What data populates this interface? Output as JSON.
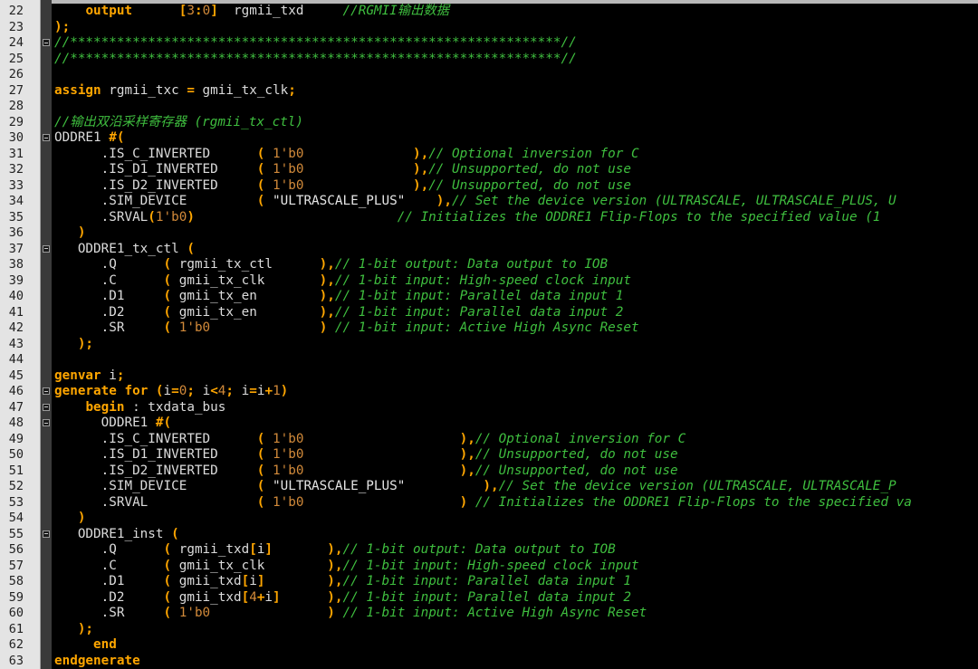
{
  "editor": {
    "first_line": 22,
    "lines": [
      {
        "no": "22",
        "fold": false,
        "tokens": [
          {
            "t": "    ",
            "c": "i"
          },
          {
            "t": "output",
            "c": "k"
          },
          {
            "t": "      ",
            "c": "i"
          },
          {
            "t": "[",
            "c": "p"
          },
          {
            "t": "3",
            "c": "n"
          },
          {
            "t": ":",
            "c": "p"
          },
          {
            "t": "0",
            "c": "n"
          },
          {
            "t": "]",
            "c": "p"
          },
          {
            "t": "  rgmii_txd     ",
            "c": "i"
          },
          {
            "t": "//RGMII输出数据",
            "c": "c"
          }
        ]
      },
      {
        "no": "23",
        "fold": false,
        "tokens": [
          {
            "t": ");",
            "c": "p"
          }
        ]
      },
      {
        "no": "24",
        "fold": true,
        "tokens": [
          {
            "t": "//***************************************************************//",
            "c": "c"
          }
        ]
      },
      {
        "no": "25",
        "fold": false,
        "tokens": [
          {
            "t": "//***************************************************************//",
            "c": "c"
          }
        ]
      },
      {
        "no": "26",
        "fold": false,
        "tokens": []
      },
      {
        "no": "27",
        "fold": false,
        "tokens": [
          {
            "t": "assign",
            "c": "k"
          },
          {
            "t": " rgmii_txc ",
            "c": "i"
          },
          {
            "t": "=",
            "c": "p"
          },
          {
            "t": " gmii_tx_clk",
            "c": "i"
          },
          {
            "t": ";",
            "c": "p"
          }
        ]
      },
      {
        "no": "28",
        "fold": false,
        "tokens": []
      },
      {
        "no": "29",
        "fold": false,
        "tokens": [
          {
            "t": "//输出双沿采样寄存器 (rgmii_tx_ctl)",
            "c": "c"
          }
        ]
      },
      {
        "no": "30",
        "fold": true,
        "tokens": [
          {
            "t": "ODDRE1 ",
            "c": "i"
          },
          {
            "t": "#(",
            "c": "p"
          }
        ]
      },
      {
        "no": "31",
        "fold": false,
        "tokens": [
          {
            "t": "      .IS_C_INVERTED      ",
            "c": "i"
          },
          {
            "t": "(",
            "c": "p"
          },
          {
            "t": " ",
            "c": "i"
          },
          {
            "t": "1'b0",
            "c": "n"
          },
          {
            "t": "              ",
            "c": "i"
          },
          {
            "t": "),",
            "c": "p"
          },
          {
            "t": "// Optional inversion for C",
            "c": "c"
          }
        ]
      },
      {
        "no": "32",
        "fold": false,
        "tokens": [
          {
            "t": "      .IS_D1_INVERTED     ",
            "c": "i"
          },
          {
            "t": "(",
            "c": "p"
          },
          {
            "t": " ",
            "c": "i"
          },
          {
            "t": "1'b0",
            "c": "n"
          },
          {
            "t": "              ",
            "c": "i"
          },
          {
            "t": "),",
            "c": "p"
          },
          {
            "t": "// Unsupported, do not use",
            "c": "c"
          }
        ]
      },
      {
        "no": "33",
        "fold": false,
        "tokens": [
          {
            "t": "      .IS_D2_INVERTED     ",
            "c": "i"
          },
          {
            "t": "(",
            "c": "p"
          },
          {
            "t": " ",
            "c": "i"
          },
          {
            "t": "1'b0",
            "c": "n"
          },
          {
            "t": "              ",
            "c": "i"
          },
          {
            "t": "),",
            "c": "p"
          },
          {
            "t": "// Unsupported, do not use",
            "c": "c"
          }
        ]
      },
      {
        "no": "34",
        "fold": false,
        "tokens": [
          {
            "t": "      .SIM_DEVICE         ",
            "c": "i"
          },
          {
            "t": "(",
            "c": "p"
          },
          {
            "t": " ",
            "c": "i"
          },
          {
            "t": "\"ULTRASCALE_PLUS\"",
            "c": "s"
          },
          {
            "t": "    ",
            "c": "i"
          },
          {
            "t": "),",
            "c": "p"
          },
          {
            "t": "// Set the device version (ULTRASCALE, ULTRASCALE_PLUS, U",
            "c": "c"
          }
        ]
      },
      {
        "no": "35",
        "fold": false,
        "tokens": [
          {
            "t": "      .SRVAL",
            "c": "i"
          },
          {
            "t": "(",
            "c": "p"
          },
          {
            "t": "1'b0",
            "c": "n"
          },
          {
            "t": ")",
            "c": "p"
          },
          {
            "t": "                          ",
            "c": "i"
          },
          {
            "t": "// Initializes the ODDRE1 Flip-Flops to the specified value (1",
            "c": "c"
          }
        ]
      },
      {
        "no": "36",
        "fold": false,
        "tokens": [
          {
            "t": "   ",
            "c": "i"
          },
          {
            "t": ")",
            "c": "p"
          }
        ]
      },
      {
        "no": "37",
        "fold": true,
        "tokens": [
          {
            "t": "   ODDRE1_tx_ctl ",
            "c": "i"
          },
          {
            "t": "(",
            "c": "p"
          }
        ]
      },
      {
        "no": "38",
        "fold": false,
        "tokens": [
          {
            "t": "      .Q      ",
            "c": "i"
          },
          {
            "t": "(",
            "c": "p"
          },
          {
            "t": " rgmii_tx_ctl      ",
            "c": "i"
          },
          {
            "t": "),",
            "c": "p"
          },
          {
            "t": "// 1-bit output: Data output to IOB",
            "c": "c"
          }
        ]
      },
      {
        "no": "39",
        "fold": false,
        "tokens": [
          {
            "t": "      .C      ",
            "c": "i"
          },
          {
            "t": "(",
            "c": "p"
          },
          {
            "t": " gmii_tx_clk       ",
            "c": "i"
          },
          {
            "t": "),",
            "c": "p"
          },
          {
            "t": "// 1-bit input: High-speed clock input",
            "c": "c"
          }
        ]
      },
      {
        "no": "40",
        "fold": false,
        "tokens": [
          {
            "t": "      .D1     ",
            "c": "i"
          },
          {
            "t": "(",
            "c": "p"
          },
          {
            "t": " gmii_tx_en        ",
            "c": "i"
          },
          {
            "t": "),",
            "c": "p"
          },
          {
            "t": "// 1-bit input: Parallel data input 1",
            "c": "c"
          }
        ]
      },
      {
        "no": "41",
        "fold": false,
        "tokens": [
          {
            "t": "      .D2     ",
            "c": "i"
          },
          {
            "t": "(",
            "c": "p"
          },
          {
            "t": " gmii_tx_en        ",
            "c": "i"
          },
          {
            "t": "),",
            "c": "p"
          },
          {
            "t": "// 1-bit input: Parallel data input 2",
            "c": "c"
          }
        ]
      },
      {
        "no": "42",
        "fold": false,
        "tokens": [
          {
            "t": "      .SR     ",
            "c": "i"
          },
          {
            "t": "(",
            "c": "p"
          },
          {
            "t": " ",
            "c": "i"
          },
          {
            "t": "1'b0",
            "c": "n"
          },
          {
            "t": "              ",
            "c": "i"
          },
          {
            "t": ")",
            "c": "p"
          },
          {
            "t": " // 1-bit input: Active High Async Reset",
            "c": "c"
          }
        ]
      },
      {
        "no": "43",
        "fold": false,
        "tokens": [
          {
            "t": "   ",
            "c": "i"
          },
          {
            "t": ");",
            "c": "p"
          }
        ]
      },
      {
        "no": "44",
        "fold": false,
        "tokens": []
      },
      {
        "no": "45",
        "fold": false,
        "tokens": [
          {
            "t": "genvar",
            "c": "k"
          },
          {
            "t": " i",
            "c": "i"
          },
          {
            "t": ";",
            "c": "p"
          }
        ]
      },
      {
        "no": "46",
        "fold": true,
        "tokens": [
          {
            "t": "generate",
            "c": "k"
          },
          {
            "t": " ",
            "c": "i"
          },
          {
            "t": "for",
            "c": "k"
          },
          {
            "t": " ",
            "c": "i"
          },
          {
            "t": "(",
            "c": "p"
          },
          {
            "t": "i",
            "c": "i"
          },
          {
            "t": "=",
            "c": "p"
          },
          {
            "t": "0",
            "c": "n"
          },
          {
            "t": ";",
            "c": "p"
          },
          {
            "t": " i",
            "c": "i"
          },
          {
            "t": "<",
            "c": "p"
          },
          {
            "t": "4",
            "c": "n"
          },
          {
            "t": ";",
            "c": "p"
          },
          {
            "t": " i",
            "c": "i"
          },
          {
            "t": "=",
            "c": "p"
          },
          {
            "t": "i",
            "c": "i"
          },
          {
            "t": "+",
            "c": "p"
          },
          {
            "t": "1",
            "c": "n"
          },
          {
            "t": ")",
            "c": "p"
          }
        ]
      },
      {
        "no": "47",
        "fold": true,
        "tokens": [
          {
            "t": "    ",
            "c": "i"
          },
          {
            "t": "begin",
            "c": "k"
          },
          {
            "t": " : txdata_bus",
            "c": "i"
          }
        ]
      },
      {
        "no": "48",
        "fold": true,
        "tokens": [
          {
            "t": "      ODDRE1 ",
            "c": "i"
          },
          {
            "t": "#(",
            "c": "p"
          }
        ]
      },
      {
        "no": "49",
        "fold": false,
        "tokens": [
          {
            "t": "      .IS_C_INVERTED      ",
            "c": "i"
          },
          {
            "t": "(",
            "c": "p"
          },
          {
            "t": " ",
            "c": "i"
          },
          {
            "t": "1'b0",
            "c": "n"
          },
          {
            "t": "                    ",
            "c": "i"
          },
          {
            "t": "),",
            "c": "p"
          },
          {
            "t": "// Optional inversion for C",
            "c": "c"
          }
        ]
      },
      {
        "no": "50",
        "fold": false,
        "tokens": [
          {
            "t": "      .IS_D1_INVERTED     ",
            "c": "i"
          },
          {
            "t": "(",
            "c": "p"
          },
          {
            "t": " ",
            "c": "i"
          },
          {
            "t": "1'b0",
            "c": "n"
          },
          {
            "t": "                    ",
            "c": "i"
          },
          {
            "t": "),",
            "c": "p"
          },
          {
            "t": "// Unsupported, do not use",
            "c": "c"
          }
        ]
      },
      {
        "no": "51",
        "fold": false,
        "tokens": [
          {
            "t": "      .IS_D2_INVERTED     ",
            "c": "i"
          },
          {
            "t": "(",
            "c": "p"
          },
          {
            "t": " ",
            "c": "i"
          },
          {
            "t": "1'b0",
            "c": "n"
          },
          {
            "t": "                    ",
            "c": "i"
          },
          {
            "t": "),",
            "c": "p"
          },
          {
            "t": "// Unsupported, do not use",
            "c": "c"
          }
        ]
      },
      {
        "no": "52",
        "fold": false,
        "tokens": [
          {
            "t": "      .SIM_DEVICE         ",
            "c": "i"
          },
          {
            "t": "(",
            "c": "p"
          },
          {
            "t": " ",
            "c": "i"
          },
          {
            "t": "\"ULTRASCALE_PLUS\"",
            "c": "s"
          },
          {
            "t": "          ",
            "c": "i"
          },
          {
            "t": "),",
            "c": "p"
          },
          {
            "t": "// Set the device version (ULTRASCALE, ULTRASCALE_P",
            "c": "c"
          }
        ]
      },
      {
        "no": "53",
        "fold": false,
        "tokens": [
          {
            "t": "      .SRVAL              ",
            "c": "i"
          },
          {
            "t": "(",
            "c": "p"
          },
          {
            "t": " ",
            "c": "i"
          },
          {
            "t": "1'b0",
            "c": "n"
          },
          {
            "t": "                    ",
            "c": "i"
          },
          {
            "t": ")",
            "c": "p"
          },
          {
            "t": " // Initializes the ODDRE1 Flip-Flops to the specified va",
            "c": "c"
          }
        ]
      },
      {
        "no": "54",
        "fold": false,
        "tokens": [
          {
            "t": "   ",
            "c": "i"
          },
          {
            "t": ")",
            "c": "p"
          }
        ]
      },
      {
        "no": "55",
        "fold": true,
        "tokens": [
          {
            "t": "   ODDRE1_inst ",
            "c": "i"
          },
          {
            "t": "(",
            "c": "p"
          }
        ]
      },
      {
        "no": "56",
        "fold": false,
        "tokens": [
          {
            "t": "      .Q      ",
            "c": "i"
          },
          {
            "t": "(",
            "c": "p"
          },
          {
            "t": " rgmii_txd",
            "c": "i"
          },
          {
            "t": "[",
            "c": "p"
          },
          {
            "t": "i",
            "c": "i"
          },
          {
            "t": "]",
            "c": "p"
          },
          {
            "t": "       ",
            "c": "i"
          },
          {
            "t": "),",
            "c": "p"
          },
          {
            "t": "// 1-bit output: Data output to IOB",
            "c": "c"
          }
        ]
      },
      {
        "no": "57",
        "fold": false,
        "tokens": [
          {
            "t": "      .C      ",
            "c": "i"
          },
          {
            "t": "(",
            "c": "p"
          },
          {
            "t": " gmii_tx_clk        ",
            "c": "i"
          },
          {
            "t": "),",
            "c": "p"
          },
          {
            "t": "// 1-bit input: High-speed clock input",
            "c": "c"
          }
        ]
      },
      {
        "no": "58",
        "fold": false,
        "tokens": [
          {
            "t": "      .D1     ",
            "c": "i"
          },
          {
            "t": "(",
            "c": "p"
          },
          {
            "t": " gmii_txd",
            "c": "i"
          },
          {
            "t": "[",
            "c": "p"
          },
          {
            "t": "i",
            "c": "i"
          },
          {
            "t": "]",
            "c": "p"
          },
          {
            "t": "        ",
            "c": "i"
          },
          {
            "t": "),",
            "c": "p"
          },
          {
            "t": "// 1-bit input: Parallel data input 1",
            "c": "c"
          }
        ]
      },
      {
        "no": "59",
        "fold": false,
        "tokens": [
          {
            "t": "      .D2     ",
            "c": "i"
          },
          {
            "t": "(",
            "c": "p"
          },
          {
            "t": " gmii_txd",
            "c": "i"
          },
          {
            "t": "[",
            "c": "p"
          },
          {
            "t": "4",
            "c": "n"
          },
          {
            "t": "+",
            "c": "p"
          },
          {
            "t": "i",
            "c": "i"
          },
          {
            "t": "]",
            "c": "p"
          },
          {
            "t": "      ",
            "c": "i"
          },
          {
            "t": "),",
            "c": "p"
          },
          {
            "t": "// 1-bit input: Parallel data input 2",
            "c": "c"
          }
        ]
      },
      {
        "no": "60",
        "fold": false,
        "tokens": [
          {
            "t": "      .SR     ",
            "c": "i"
          },
          {
            "t": "(",
            "c": "p"
          },
          {
            "t": " ",
            "c": "i"
          },
          {
            "t": "1'b0",
            "c": "n"
          },
          {
            "t": "               ",
            "c": "i"
          },
          {
            "t": ")",
            "c": "p"
          },
          {
            "t": " // 1-bit input: Active High Async Reset",
            "c": "c"
          }
        ]
      },
      {
        "no": "61",
        "fold": false,
        "tokens": [
          {
            "t": "   ",
            "c": "i"
          },
          {
            "t": ");",
            "c": "p"
          }
        ]
      },
      {
        "no": "62",
        "fold": false,
        "tokens": [
          {
            "t": "     ",
            "c": "i"
          },
          {
            "t": "end",
            "c": "k"
          }
        ]
      },
      {
        "no": "63",
        "fold": false,
        "tokens": [
          {
            "t": "endgenerate",
            "c": "k"
          }
        ]
      }
    ]
  },
  "colors": {
    "background": "#000000",
    "gutter": "#e4e4e4",
    "keyword": "#ffa600",
    "comment": "#3fbf3f",
    "number": "#d28a3a",
    "identifier": "#dcdcdc"
  }
}
